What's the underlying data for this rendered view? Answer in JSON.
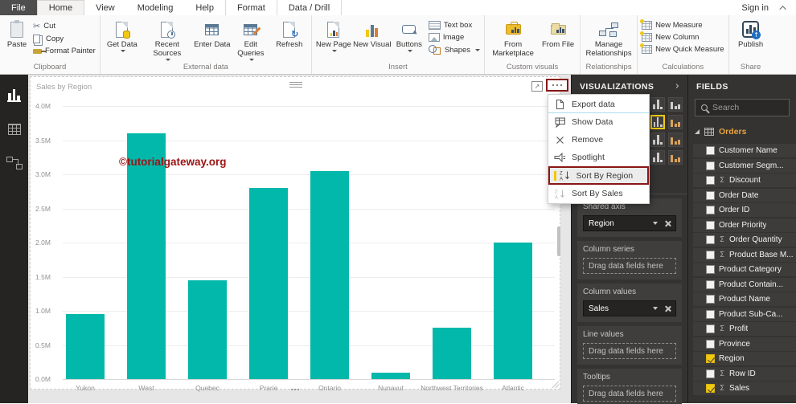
{
  "ribbon": {
    "file_tab": "File",
    "tabs": [
      "Home",
      "View",
      "Modeling",
      "Help",
      "Format",
      "Data / Drill"
    ],
    "active_tab": "Home",
    "sign_in": "Sign in",
    "clipboard": {
      "label": "Clipboard",
      "paste": "Paste",
      "cut": "Cut",
      "copy": "Copy",
      "format_painter": "Format Painter"
    },
    "external_data": {
      "label": "External data",
      "get_data": "Get Data",
      "recent_sources": "Recent Sources",
      "enter_data": "Enter Data",
      "edit_queries": "Edit Queries",
      "refresh": "Refresh"
    },
    "insert": {
      "label": "Insert",
      "new_page": "New Page",
      "new_visual": "New Visual",
      "buttons": "Buttons",
      "text_box": "Text box",
      "image": "Image",
      "shapes": "Shapes"
    },
    "custom_visuals": {
      "label": "Custom visuals",
      "from_marketplace": "From Marketplace",
      "from_file": "From File"
    },
    "relationships": {
      "label": "Relationships",
      "manage_relationships": "Manage Relationships"
    },
    "calculations": {
      "label": "Calculations",
      "new_measure": "New Measure",
      "new_column": "New Column",
      "new_quick_measure": "New Quick Measure"
    },
    "share": {
      "label": "Share",
      "publish": "Publish"
    }
  },
  "context_menu": {
    "items": [
      {
        "label": "Export data",
        "icon": "export-data-icon",
        "highlighted": false
      },
      {
        "label": "Show Data",
        "icon": "show-data-icon",
        "highlighted": false
      },
      {
        "label": "Remove",
        "icon": "remove-icon",
        "highlighted": false
      },
      {
        "label": "Spotlight",
        "icon": "spotlight-icon",
        "highlighted": false
      },
      {
        "label": "Sort By Region",
        "icon": "sort-icon",
        "highlighted": true
      },
      {
        "label": "Sort By Sales",
        "icon": "sort-icon-muted",
        "highlighted": false
      }
    ]
  },
  "visualizations_pane": {
    "title": "VISUALIZATIONS",
    "selected_visual": "line-and-clustered-column-chart",
    "wells": [
      {
        "label": "Shared axis",
        "pill": "Region"
      },
      {
        "label": "Column series",
        "placeholder": "Drag data fields here"
      },
      {
        "label": "Column values",
        "pill": "Sales"
      },
      {
        "label": "Line values",
        "placeholder": "Drag data fields here"
      },
      {
        "label": "Tooltips",
        "placeholder": "Drag data fields here"
      }
    ]
  },
  "fields_pane": {
    "title": "FIELDS",
    "search_placeholder": "Search",
    "table_name": "Orders",
    "fields": [
      {
        "name": "Customer Name",
        "sigma": false,
        "checked": false
      },
      {
        "name": "Customer Segm...",
        "sigma": false,
        "checked": false
      },
      {
        "name": "Discount",
        "sigma": true,
        "checked": false
      },
      {
        "name": "Order Date",
        "sigma": false,
        "checked": false
      },
      {
        "name": "Order ID",
        "sigma": false,
        "checked": false
      },
      {
        "name": "Order Priority",
        "sigma": false,
        "checked": false
      },
      {
        "name": "Order Quantity",
        "sigma": true,
        "checked": false
      },
      {
        "name": "Product Base M...",
        "sigma": true,
        "checked": false
      },
      {
        "name": "Product Category",
        "sigma": false,
        "checked": false
      },
      {
        "name": "Product Contain...",
        "sigma": false,
        "checked": false
      },
      {
        "name": "Product Name",
        "sigma": false,
        "checked": false
      },
      {
        "name": "Product Sub-Ca...",
        "sigma": false,
        "checked": false
      },
      {
        "name": "Profit",
        "sigma": true,
        "checked": false
      },
      {
        "name": "Province",
        "sigma": false,
        "checked": false
      },
      {
        "name": "Region",
        "sigma": false,
        "checked": true
      },
      {
        "name": "Row ID",
        "sigma": true,
        "checked": false
      },
      {
        "name": "Sales",
        "sigma": true,
        "checked": true
      }
    ]
  },
  "chart_data": {
    "type": "bar",
    "title": "Sales by Region",
    "categories": [
      "Yukon",
      "West",
      "Quebec",
      "Prarie",
      "Ontario",
      "Nunavut",
      "Northwest Territories",
      "Atlantic"
    ],
    "values": [
      0.95,
      3.6,
      1.45,
      2.8,
      3.05,
      0.1,
      0.75,
      2.0
    ],
    "unit": "M",
    "ylim": [
      0,
      4
    ],
    "ytick_step": 0.5,
    "grid": true,
    "legend": "none",
    "bar_color": "#01b8aa"
  },
  "watermark": "©tutorialgateway.org",
  "colors": {
    "accent_teal": "#01b8aa",
    "accent_yellow": "#f2c811",
    "annotation_red": "#8a1616",
    "pane_bg": "#343332"
  }
}
